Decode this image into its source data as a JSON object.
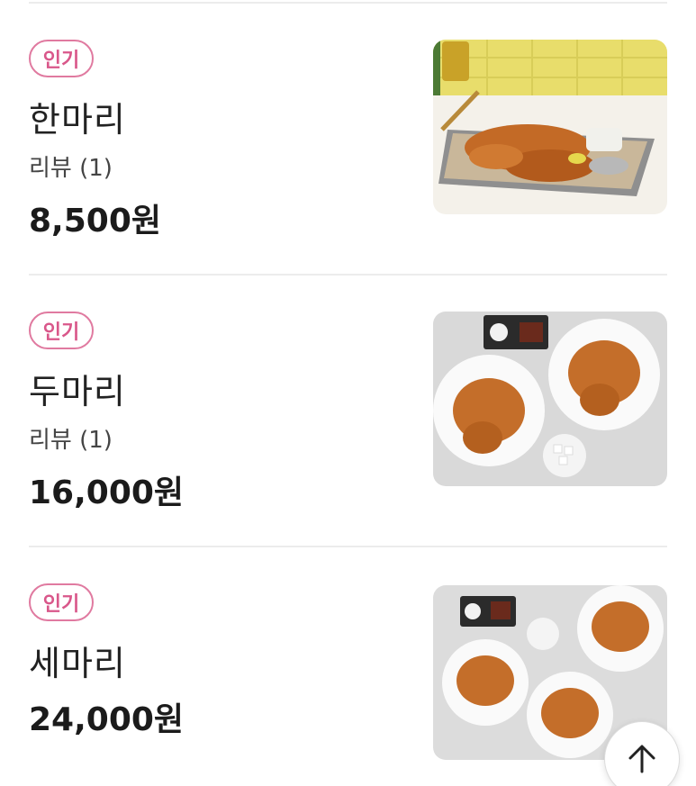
{
  "items": [
    {
      "badge": "인기",
      "name": "한마리",
      "review": "리뷰 (1)",
      "price": "8,500원",
      "image_icon": "one-chicken-photo"
    },
    {
      "badge": "인기",
      "name": "두마리",
      "review": "리뷰 (1)",
      "price": "16,000원",
      "image_icon": "two-chicken-photo"
    },
    {
      "badge": "인기",
      "name": "세마리",
      "price": "24,000원",
      "image_icon": "three-chicken-photo"
    }
  ],
  "scroll_top_icon": "arrow-up-icon",
  "colors": {
    "badge": "#e07aa0",
    "badge_text": "#d9578a",
    "divider": "#ececec"
  }
}
